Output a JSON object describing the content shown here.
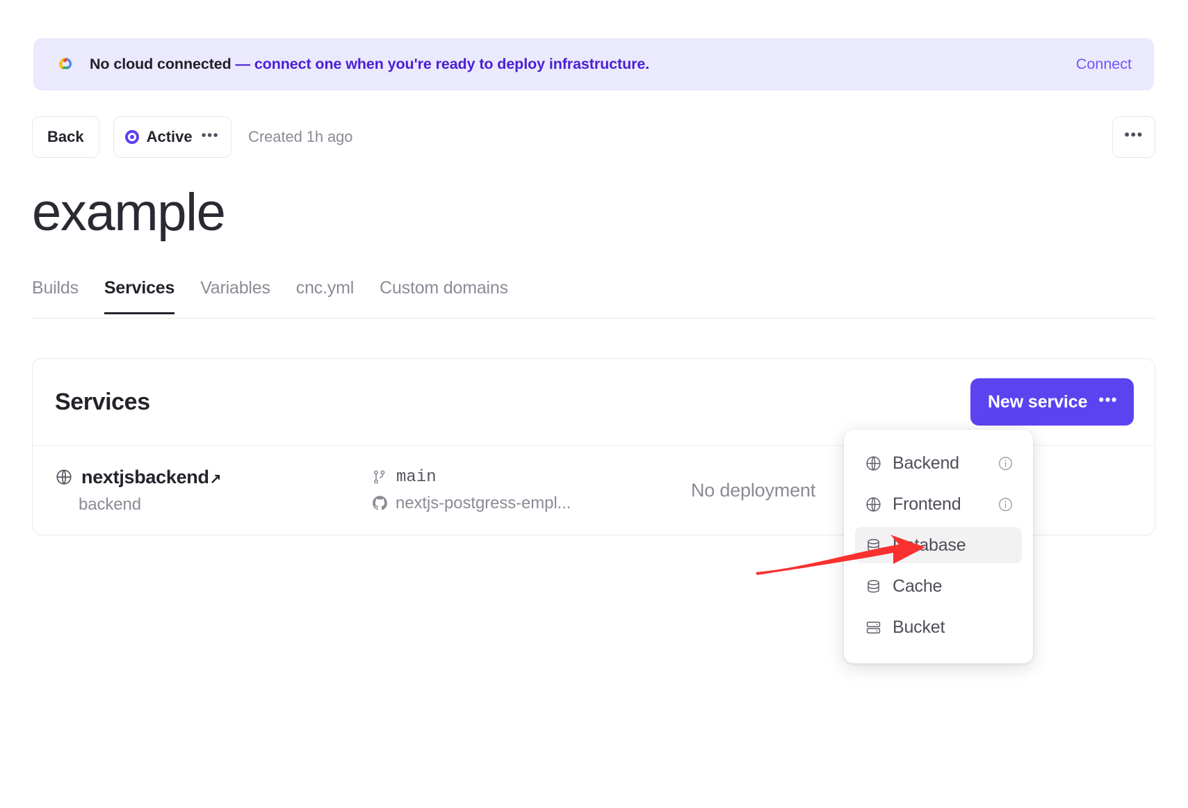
{
  "banner": {
    "icon": "google-cloud-icon",
    "text_strong": "No cloud connected",
    "text_rest": " — connect one when you're ready to deploy infrastructure.",
    "connect_label": "Connect",
    "bg_color": "#ebe9fd",
    "link_color": "#6e56f8"
  },
  "toolbar": {
    "back_label": "Back",
    "status_label": "Active",
    "status_color": "#5b43f0",
    "status_more_glyph": "•••",
    "created_label": "Created 1h ago",
    "more_glyph": "•••"
  },
  "page_title": "example",
  "tabs": [
    {
      "label": "Builds",
      "active": false
    },
    {
      "label": "Services",
      "active": true
    },
    {
      "label": "Variables",
      "active": false
    },
    {
      "label": "cnc.yml",
      "active": false
    },
    {
      "label": "Custom domains",
      "active": false
    }
  ],
  "services_card": {
    "title": "Services",
    "new_service_label": "New service",
    "new_service_glyph": "•••",
    "accent_color": "#5b43f0",
    "rows": [
      {
        "icon": "globe-icon",
        "name": "nextjsbackend",
        "external_glyph": "↗",
        "subtitle": "backend",
        "branch_icon": "git-branch-icon",
        "branch": "main",
        "repo_icon": "github-icon",
        "repo": "nextjs-postgress-empl...",
        "status": "No deployment"
      }
    ]
  },
  "dropdown": {
    "items": [
      {
        "icon": "globe-icon",
        "label": "Backend",
        "info": true,
        "highlighted": false
      },
      {
        "icon": "globe-icon",
        "label": "Frontend",
        "info": true,
        "highlighted": false
      },
      {
        "icon": "database-icon",
        "label": "Database",
        "info": false,
        "highlighted": true
      },
      {
        "icon": "database-icon",
        "label": "Cache",
        "info": false,
        "highlighted": false
      },
      {
        "icon": "bucket-icon",
        "label": "Bucket",
        "info": false,
        "highlighted": false
      }
    ]
  },
  "annotation": {
    "arrow_color": "#f8312f",
    "points_at": "Database"
  }
}
